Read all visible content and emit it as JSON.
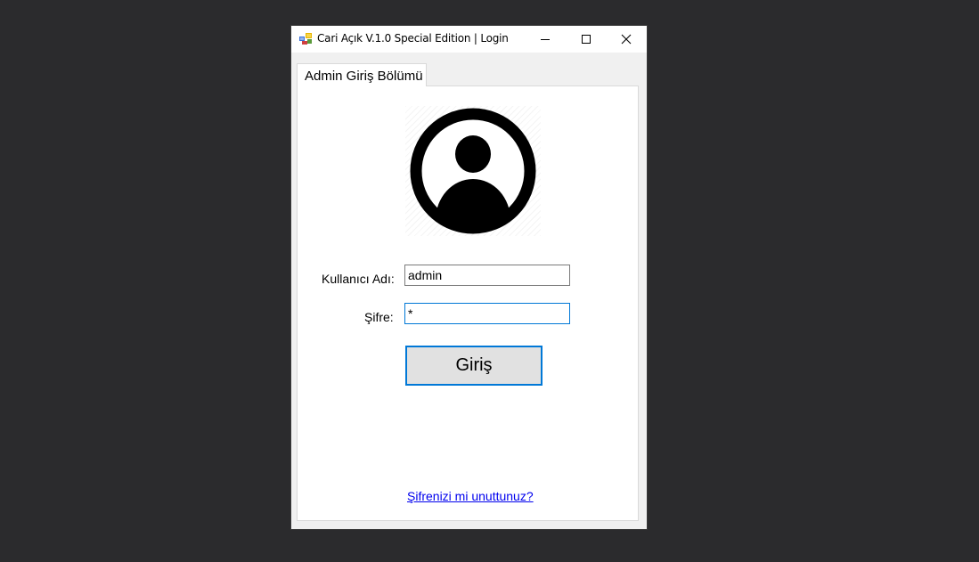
{
  "window": {
    "title": "Cari Açık V.1.0 Special Edition  |  Login",
    "icon": "app-grid-icon",
    "controls": {
      "minimize_icon": "minimize-icon",
      "maximize_icon": "maximize-icon",
      "close_icon": "close-icon"
    }
  },
  "tab": {
    "label": "Admin Giriş Bölümü"
  },
  "login_form": {
    "avatar_icon": "user-avatar-icon",
    "username_label": "Kullanıcı Adı:",
    "username_value": "admin",
    "password_label": "Şifre:",
    "password_value": "*",
    "submit_label": "Giriş",
    "forgot_link": "Şifrenizi mi unuttunuz?"
  },
  "colors": {
    "focus_accent": "#0078d7",
    "link": "#0000ee",
    "desktop_bg": "#2b2b2d"
  }
}
